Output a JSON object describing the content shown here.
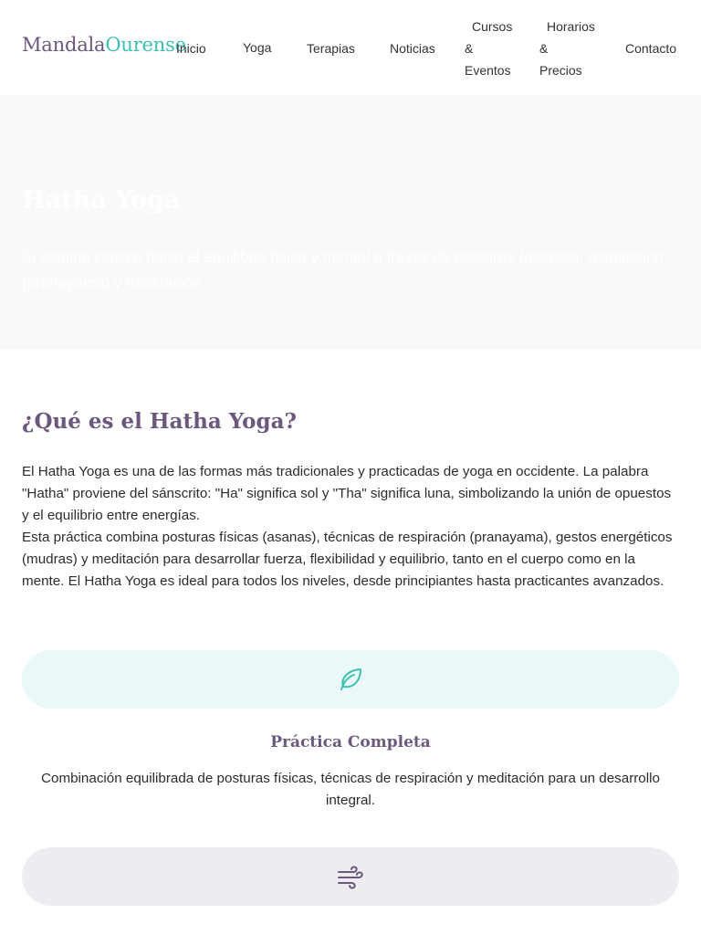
{
  "header": {
    "logo": {
      "part1": "Mandala",
      "part2": "Ourense"
    },
    "nav": [
      {
        "lines": [
          "Inicio"
        ]
      },
      {
        "lines": [
          "Yoga"
        ]
      },
      {
        "lines": [
          "Terapias"
        ]
      },
      {
        "lines": [
          "Noticias"
        ]
      },
      {
        "lines": [
          "Cursos",
          "&",
          "Eventos"
        ]
      },
      {
        "lines": [
          "Horarios",
          "&",
          "Precios"
        ]
      },
      {
        "lines": [
          "Contacto"
        ]
      }
    ]
  },
  "hero": {
    "title": "Hatha Yoga",
    "subtitle": "El camino clásico hacia el equilibrio físico y mental a través de posturas (asanas), respiración (pranayama) y meditación."
  },
  "intro": {
    "title": "¿Qué es el Hatha Yoga?",
    "paragraphs": [
      "El Hatha Yoga es una de las formas más tradicionales y practicadas de yoga en occidente. La palabra \"Hatha\" proviene del sánscrito: \"Ha\" significa sol y \"Tha\" significa luna, simbolizando la unión de opuestos y el equilibrio entre energías.",
      "Esta práctica combina posturas físicas (asanas), técnicas de respiración (pranayama), gestos energéticos (mudras) y meditación para desarrollar fuerza, flexibilidad y equilibrio, tanto en el cuerpo como en la mente. El Hatha Yoga es ideal para todos los niveles, desde principiantes hasta practicantes avanzados."
    ]
  },
  "features": [
    {
      "icon": "leaf-icon",
      "title": "Práctica Completa",
      "description": "Combinación equilibrada de posturas físicas, técnicas de respiración y meditación para un desarrollo integral."
    },
    {
      "icon": "wind-icon"
    }
  ],
  "colors": {
    "brand_purple": "#6b587c",
    "brand_teal": "#3cc0b3",
    "pill_teal": "#eaf8f7",
    "pill_purple": "#efecf1",
    "hero_bg": "#f9f9f9"
  }
}
